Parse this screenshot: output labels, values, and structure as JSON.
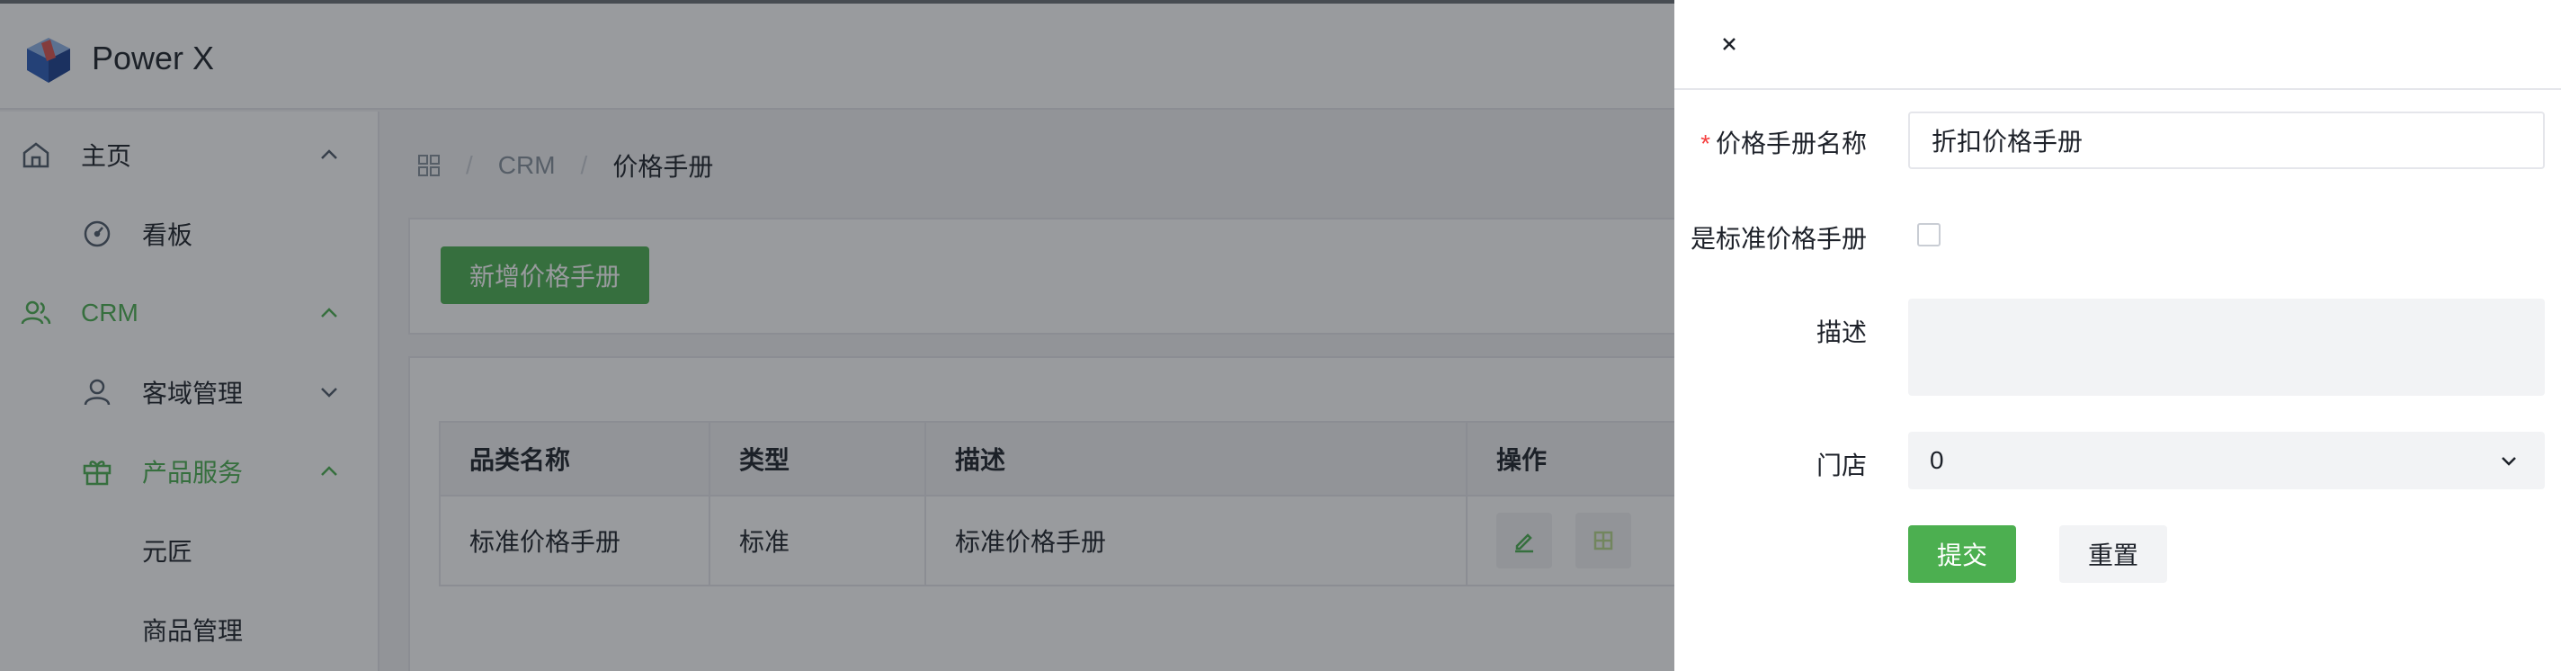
{
  "app": {
    "title": "Power X"
  },
  "sidebar": {
    "items": [
      {
        "label": "主页",
        "icon": "home-icon"
      },
      {
        "label": "看板",
        "icon": "dashboard-icon"
      },
      {
        "label": "CRM",
        "icon": "users-icon",
        "active": true
      },
      {
        "label": "客域管理",
        "icon": "user-icon"
      },
      {
        "label": "产品服务",
        "icon": "gift-icon",
        "active": true
      },
      {
        "label": "元匠"
      },
      {
        "label": "商品管理"
      }
    ]
  },
  "breadcrumb": {
    "items": [
      "CRM",
      "价格手册"
    ]
  },
  "toolbar": {
    "add_label": "新增价格手册"
  },
  "table": {
    "headers": [
      "品类名称",
      "类型",
      "描述",
      "操作"
    ],
    "rows": [
      {
        "name": "标准价格手册",
        "type": "标准",
        "description": "标准价格手册"
      }
    ]
  },
  "drawer": {
    "form": {
      "name_label": "价格手册名称",
      "name_value": "折扣价格手册",
      "is_standard_label": "是标准价格手册",
      "is_standard_checked": false,
      "description_label": "描述",
      "description_value": "",
      "store_label": "门店",
      "store_value": "0",
      "submit_label": "提交",
      "reset_label": "重置"
    }
  },
  "colors": {
    "primary": "#4caf50",
    "required": "#f53f3f"
  }
}
